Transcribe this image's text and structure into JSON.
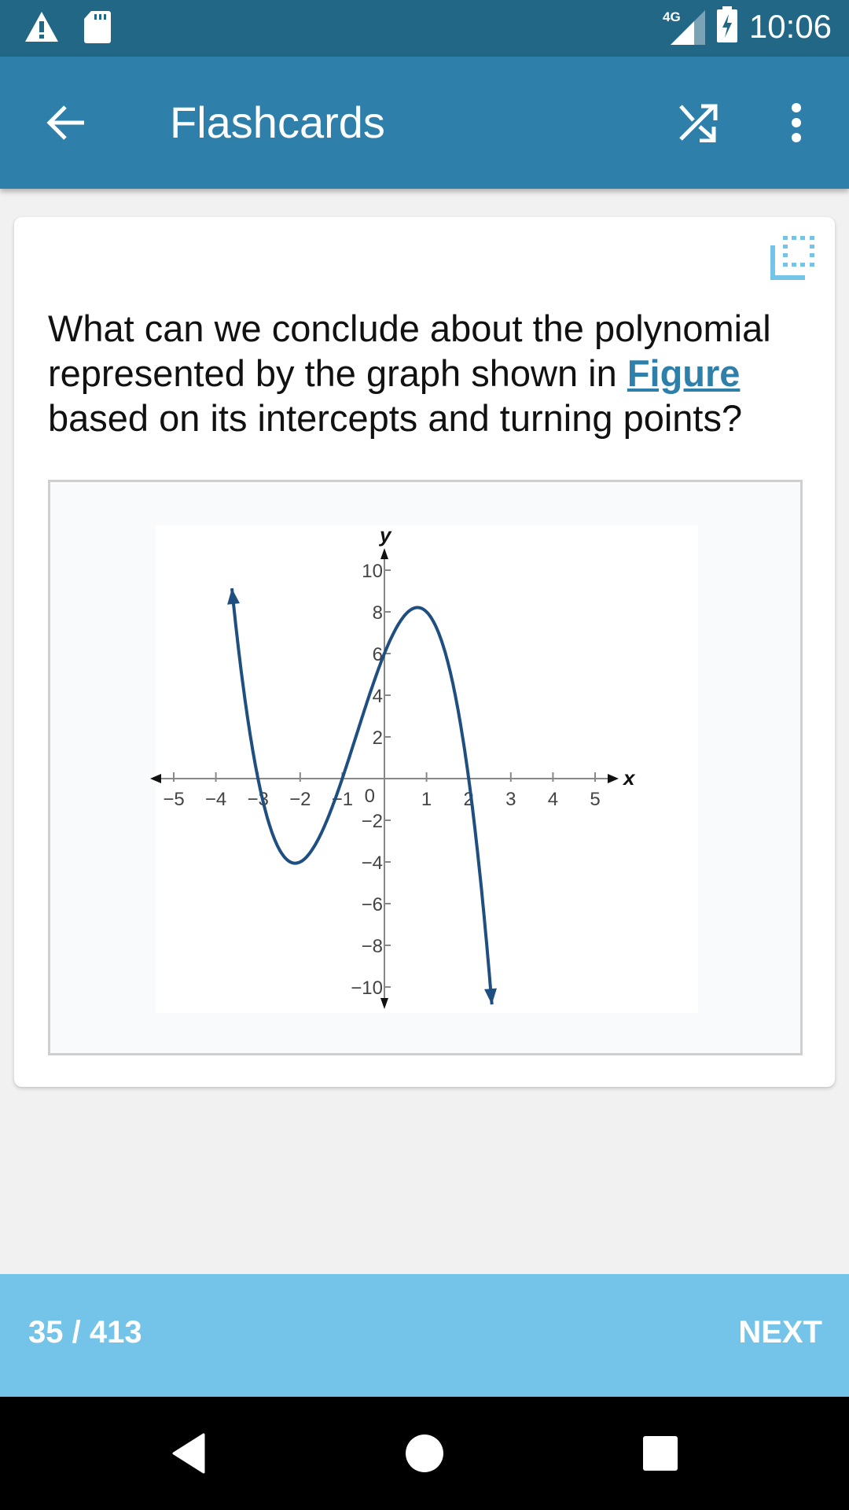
{
  "status_bar": {
    "time": "10:06",
    "network": "4G",
    "icons": [
      "warning-icon",
      "sd-card-icon",
      "signal-icon",
      "battery-charging-icon"
    ]
  },
  "app_bar": {
    "title": "Flashcards",
    "back_icon": "arrow-left-icon",
    "shuffle_icon": "shuffle-icon",
    "more_icon": "more-vert-icon"
  },
  "card": {
    "copy_icon": "copy-icon",
    "question_before": "What can we conclude about the polynomial represented by the graph shown in ",
    "question_link": "Figure",
    "question_after": " based on its intercepts and turning points?"
  },
  "chart_data": {
    "type": "line",
    "title": "",
    "xlabel": "x",
    "ylabel": "y",
    "xlim": [
      -5,
      5
    ],
    "ylim": [
      -10,
      10
    ],
    "x_ticks": [
      "−5",
      "−4",
      "−3",
      "−2",
      "−1",
      "0",
      "1",
      "2",
      "3",
      "4",
      "5"
    ],
    "y_ticks": [
      "10",
      "8",
      "6",
      "4",
      "2",
      "−2",
      "−4",
      "−6",
      "−8",
      "−10"
    ],
    "x_tick_values": [
      -5,
      -4,
      -3,
      -2,
      -1,
      1,
      2,
      3,
      4,
      5
    ],
    "y_tick_values": [
      10,
      8,
      6,
      4,
      2,
      -2,
      -4,
      -6,
      -8,
      -10
    ],
    "origin_label": "0",
    "series": [
      {
        "name": "polynomial",
        "function": "-(x+3)(x+1)(x-2)",
        "x_range": [
          -3.62,
          2.55
        ],
        "color": "#1f4e80",
        "key_points": [
          {
            "x": -3,
            "y": 0
          },
          {
            "x": -2,
            "y": -4
          },
          {
            "x": -1,
            "y": 0
          },
          {
            "x": 0,
            "y": 6
          },
          {
            "x": 1,
            "y": 8
          },
          {
            "x": 2,
            "y": 0
          }
        ],
        "end_arrows": true
      }
    ],
    "grid": false,
    "legend": "none"
  },
  "bottom_bar": {
    "counter": "35 / 413",
    "current": 35,
    "total": 413,
    "next_label": "NEXT"
  },
  "nav_bar": {
    "buttons": [
      "back-triangle-icon",
      "home-circle-icon",
      "recents-square-icon"
    ]
  }
}
